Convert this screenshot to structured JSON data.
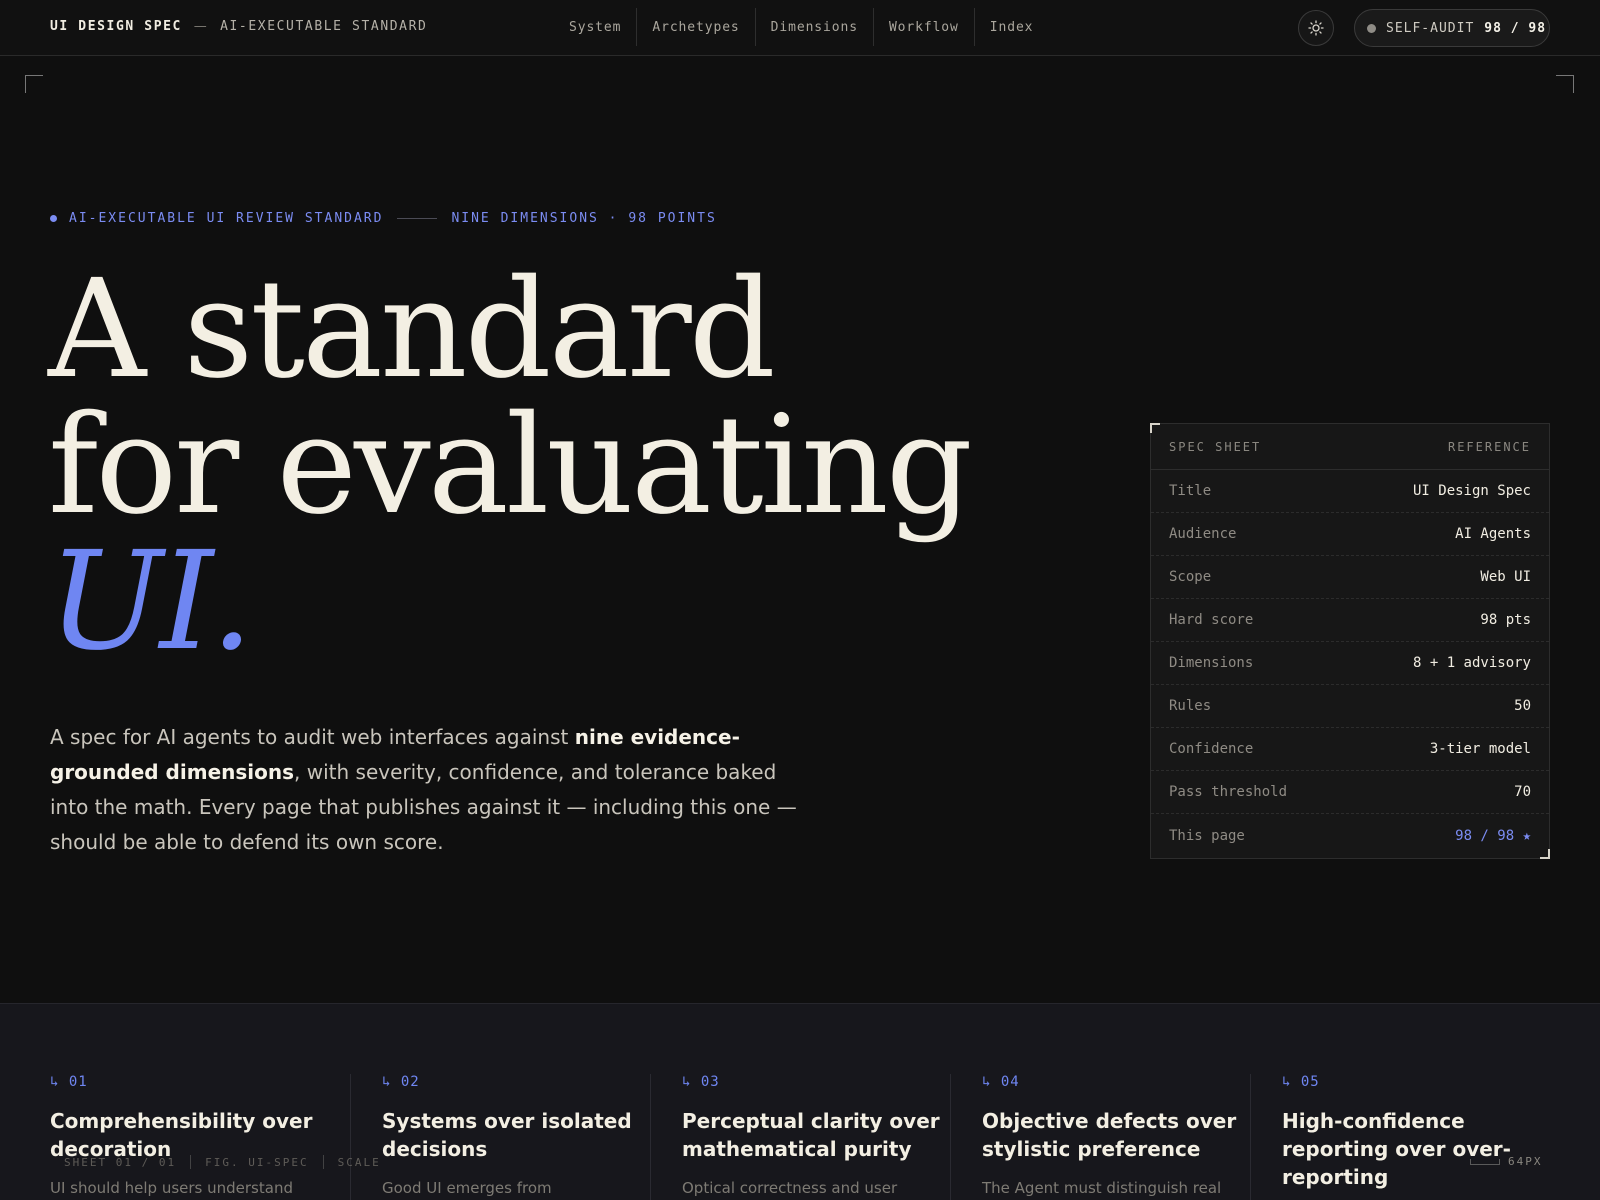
{
  "header": {
    "brand_name": "UI DESIGN SPEC",
    "brand_dash": "—",
    "brand_tag": "AI-EXECUTABLE STANDARD",
    "nav": [
      "System",
      "Archetypes",
      "Dimensions",
      "Workflow",
      "Index"
    ],
    "theme_toggle_icon": "sun-icon",
    "audit_label": "SELF-AUDIT",
    "audit_score": "98 / 98"
  },
  "hero": {
    "eyebrow_left": "AI-EXECUTABLE UI REVIEW STANDARD",
    "eyebrow_right": "NINE DIMENSIONS · 98 POINTS",
    "title_line1": "A standard",
    "title_line2": "for evaluating",
    "title_line3": "UI.",
    "desc_part1": "A spec for AI agents to audit web interfaces against ",
    "desc_bold": "nine evidence-grounded dimensions",
    "desc_part2": ", with severity, confidence, and tolerance baked into the math. Every page that publishes against it — including this one — should be able to defend its own score."
  },
  "spec_sheet": {
    "header_left": "SPEC SHEET",
    "header_right": "REFERENCE",
    "rows": [
      {
        "key": "Title",
        "value": "UI Design Spec"
      },
      {
        "key": "Audience",
        "value": "AI Agents"
      },
      {
        "key": "Scope",
        "value": "Web UI"
      },
      {
        "key": "Hard score",
        "value": "98 pts"
      },
      {
        "key": "Dimensions",
        "value": "8 + 1 advisory"
      },
      {
        "key": "Rules",
        "value": "50"
      },
      {
        "key": "Confidence",
        "value": "3-tier model"
      },
      {
        "key": "Pass threshold",
        "value": "70"
      },
      {
        "key": "This page",
        "value": "98 / 98 ★"
      }
    ]
  },
  "principles": [
    {
      "num": "↳ 01",
      "title": "Comprehensibility over decoration",
      "body": "UI should help users understand"
    },
    {
      "num": "↳ 02",
      "title": "Systems over isolated decisions",
      "body": "Good UI emerges from"
    },
    {
      "num": "↳ 03",
      "title": "Perceptual clarity over mathematical purity",
      "body": "Optical correctness and user"
    },
    {
      "num": "↳ 04",
      "title": "Objective defects over stylistic preference",
      "body": "The Agent must distinguish real"
    },
    {
      "num": "↳ 05",
      "title": "High-confidence reporting over over-reporting",
      "body": ""
    }
  ],
  "figure_caption": {
    "parts": [
      "SHEET 01 / 01",
      "FIG. UI-SPEC",
      "SCALE"
    ],
    "scale_value": "64PX"
  },
  "colors": {
    "background": "#0f0f0f",
    "accent": "#6f86f2",
    "text": "#f1ede2"
  }
}
